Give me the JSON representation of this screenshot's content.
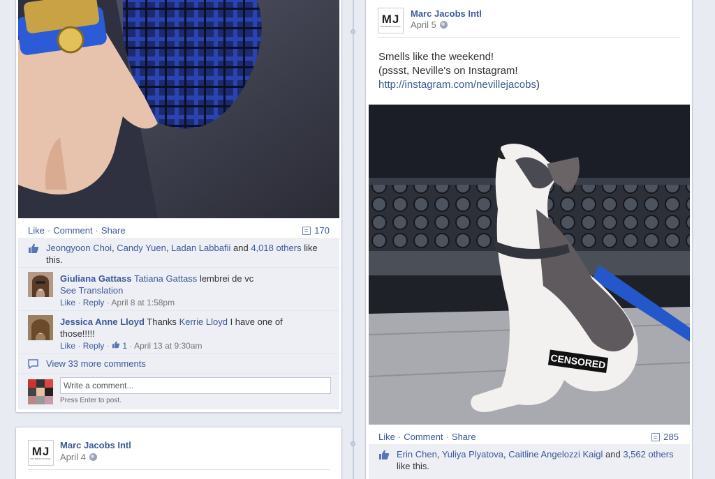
{
  "left_post": {
    "actions": {
      "like": "Like",
      "comment": "Comment",
      "share": "Share",
      "sep": "·"
    },
    "comment_count": "170",
    "likes": {
      "names": [
        "Jeongyoon Choi",
        "Candy Yuen",
        "Ladan Labbafii"
      ],
      "and": "and",
      "others": "4,018 others",
      "suffix": "like this."
    },
    "comments": [
      {
        "author": "Giuliana Gattass",
        "mention": "Tatiana Gattass",
        "text": "lembrei de vc",
        "translate": "See Translation",
        "like": "Like",
        "reply": "Reply",
        "time": "April 8 at 1:58pm"
      },
      {
        "author": "Jessica Anne Lloyd",
        "pre": "Thanks",
        "mention": "Kerrie Lloyd",
        "text": "I have one of those!!!!!",
        "like": "Like",
        "reply": "Reply",
        "likes": "1",
        "time": "April 13 at 9:30am"
      }
    ],
    "view_more": "View 33 more comments",
    "write_placeholder": "Write a comment...",
    "enter_hint": "Press Enter to post."
  },
  "left_post_2": {
    "page_name": "Marc Jacobs Intl",
    "date": "April 4",
    "logo_text": "MJ",
    "logo_sub": "INTERNATIONAL"
  },
  "right_post": {
    "page_name": "Marc Jacobs Intl",
    "date": "April 5",
    "logo_text": "MJ",
    "logo_sub": "INTERNATIONAL",
    "text_line1": "Smells like the weekend!",
    "text_line2": "(pssst, Neville's on Instagram!",
    "link": "http://instagram.com/nevillejacobs",
    "link_close": ")",
    "censored": "CENSORED",
    "actions": {
      "like": "Like",
      "comment": "Comment",
      "share": "Share",
      "sep": "·"
    },
    "comment_count": "285",
    "likes": {
      "names": [
        "Erin Chen",
        "Yuliya Plyatova",
        "Caitline Angelozzi Kaigl"
      ],
      "and": "and",
      "others": "3,562 others",
      "suffix": "like this."
    }
  },
  "colors": {
    "link": "#3b5998",
    "background": "#e9ebf2",
    "ufi_bg": "#edeff4"
  }
}
